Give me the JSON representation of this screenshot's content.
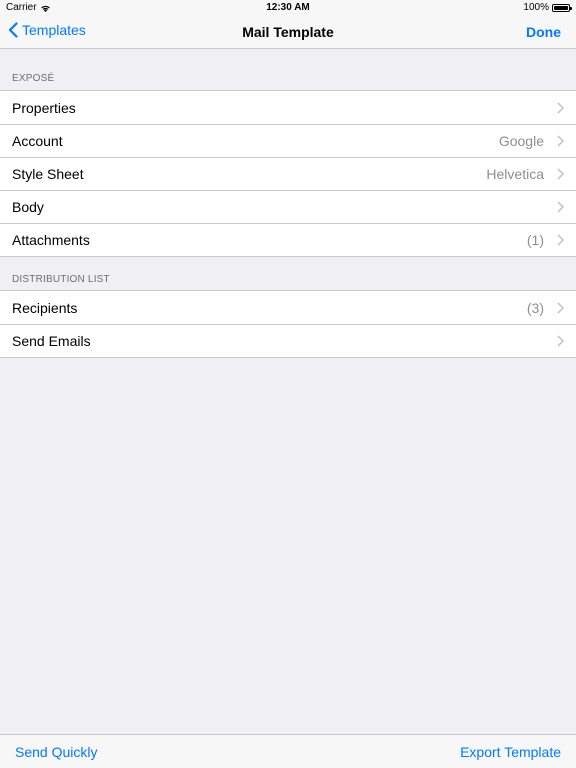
{
  "status_bar": {
    "carrier": "Carrier",
    "time": "12:30 AM",
    "battery": "100%"
  },
  "nav": {
    "back_label": "Templates",
    "title": "Mail Template",
    "done_label": "Done"
  },
  "sections": [
    {
      "header": "EXPOSÉ",
      "rows": [
        {
          "label": "Properties",
          "detail": ""
        },
        {
          "label": "Account",
          "detail": "Google"
        },
        {
          "label": "Style Sheet",
          "detail": "Helvetica"
        },
        {
          "label": "Body",
          "detail": ""
        },
        {
          "label": "Attachments",
          "detail": "(1)"
        }
      ]
    },
    {
      "header": "DISTRIBUTION LIST",
      "rows": [
        {
          "label": "Recipients",
          "detail": "(3)"
        },
        {
          "label": "Send Emails",
          "detail": ""
        }
      ]
    }
  ],
  "toolbar": {
    "left_label": "Send Quickly",
    "right_label": "Export Template"
  },
  "colors": {
    "accent": "#007aff",
    "background": "#efeff4",
    "detail_text": "#8e8e93"
  }
}
